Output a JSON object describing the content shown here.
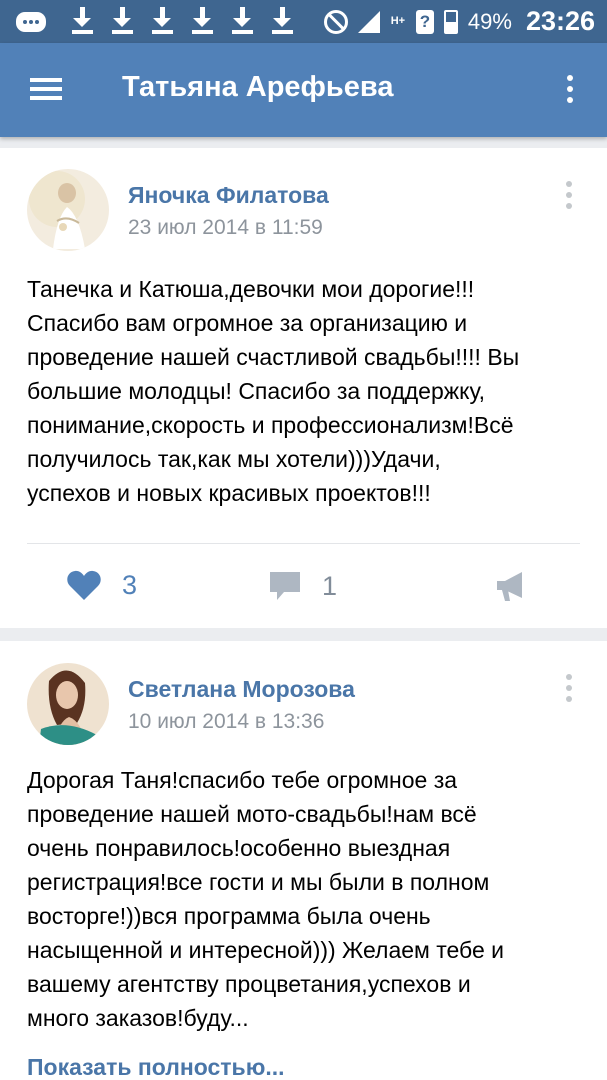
{
  "status_bar": {
    "battery_percent": "49%",
    "time": "23:26",
    "network_label": "H+",
    "sim_label": "?",
    "download_count": 6,
    "icons": [
      "chat-icon",
      "download-icon",
      "block-icon",
      "signal-icon",
      "sim-question-icon",
      "battery-icon"
    ]
  },
  "app_bar": {
    "title": "Татьяна Арефьева",
    "icons": [
      "menu-icon",
      "more-vertical-icon"
    ]
  },
  "posts": [
    {
      "author": "Яночка Филатова",
      "date": "23 июл 2014 в 11:59",
      "text": "Танечка и Катюша,девочки мои дорогие!!!\nСпасибо вам огромное за организацию и\nпроведение нашей счастливой свадьбы!!!! Вы\nбольшие молодцы! Спасибо за поддержку,\nпонимание,скорость и профессионализм!Всё\nполучилось так,как мы хотели)))Удачи,\nуспехов и новых красивых проектов!!!",
      "likes": "3",
      "comments": "1"
    },
    {
      "author": "Светлана Морозова",
      "date": "10 июл 2014 в 13:36",
      "text": "Дорогая Таня!спасибо тебе огромное за\nпроведение нашей мото-свадьбы!нам всё\nочень понравилось!особенно выездная\nрегистрация!все гости и мы были в полном\nвосторге!))вся программа была очень\nнасыщенной и интересной))) Желаем тебе и\nвашему агентству процветания,успехов и\nмного заказов!буду...",
      "show_more": "Показать полностью..."
    }
  ],
  "colors": {
    "status_bar": "#3f6690",
    "app_bar": "#5181b8",
    "link": "#4a76a8",
    "like_active": "#5181b8",
    "muted_icon": "#aeb7c2",
    "background": "#ebedf0"
  }
}
